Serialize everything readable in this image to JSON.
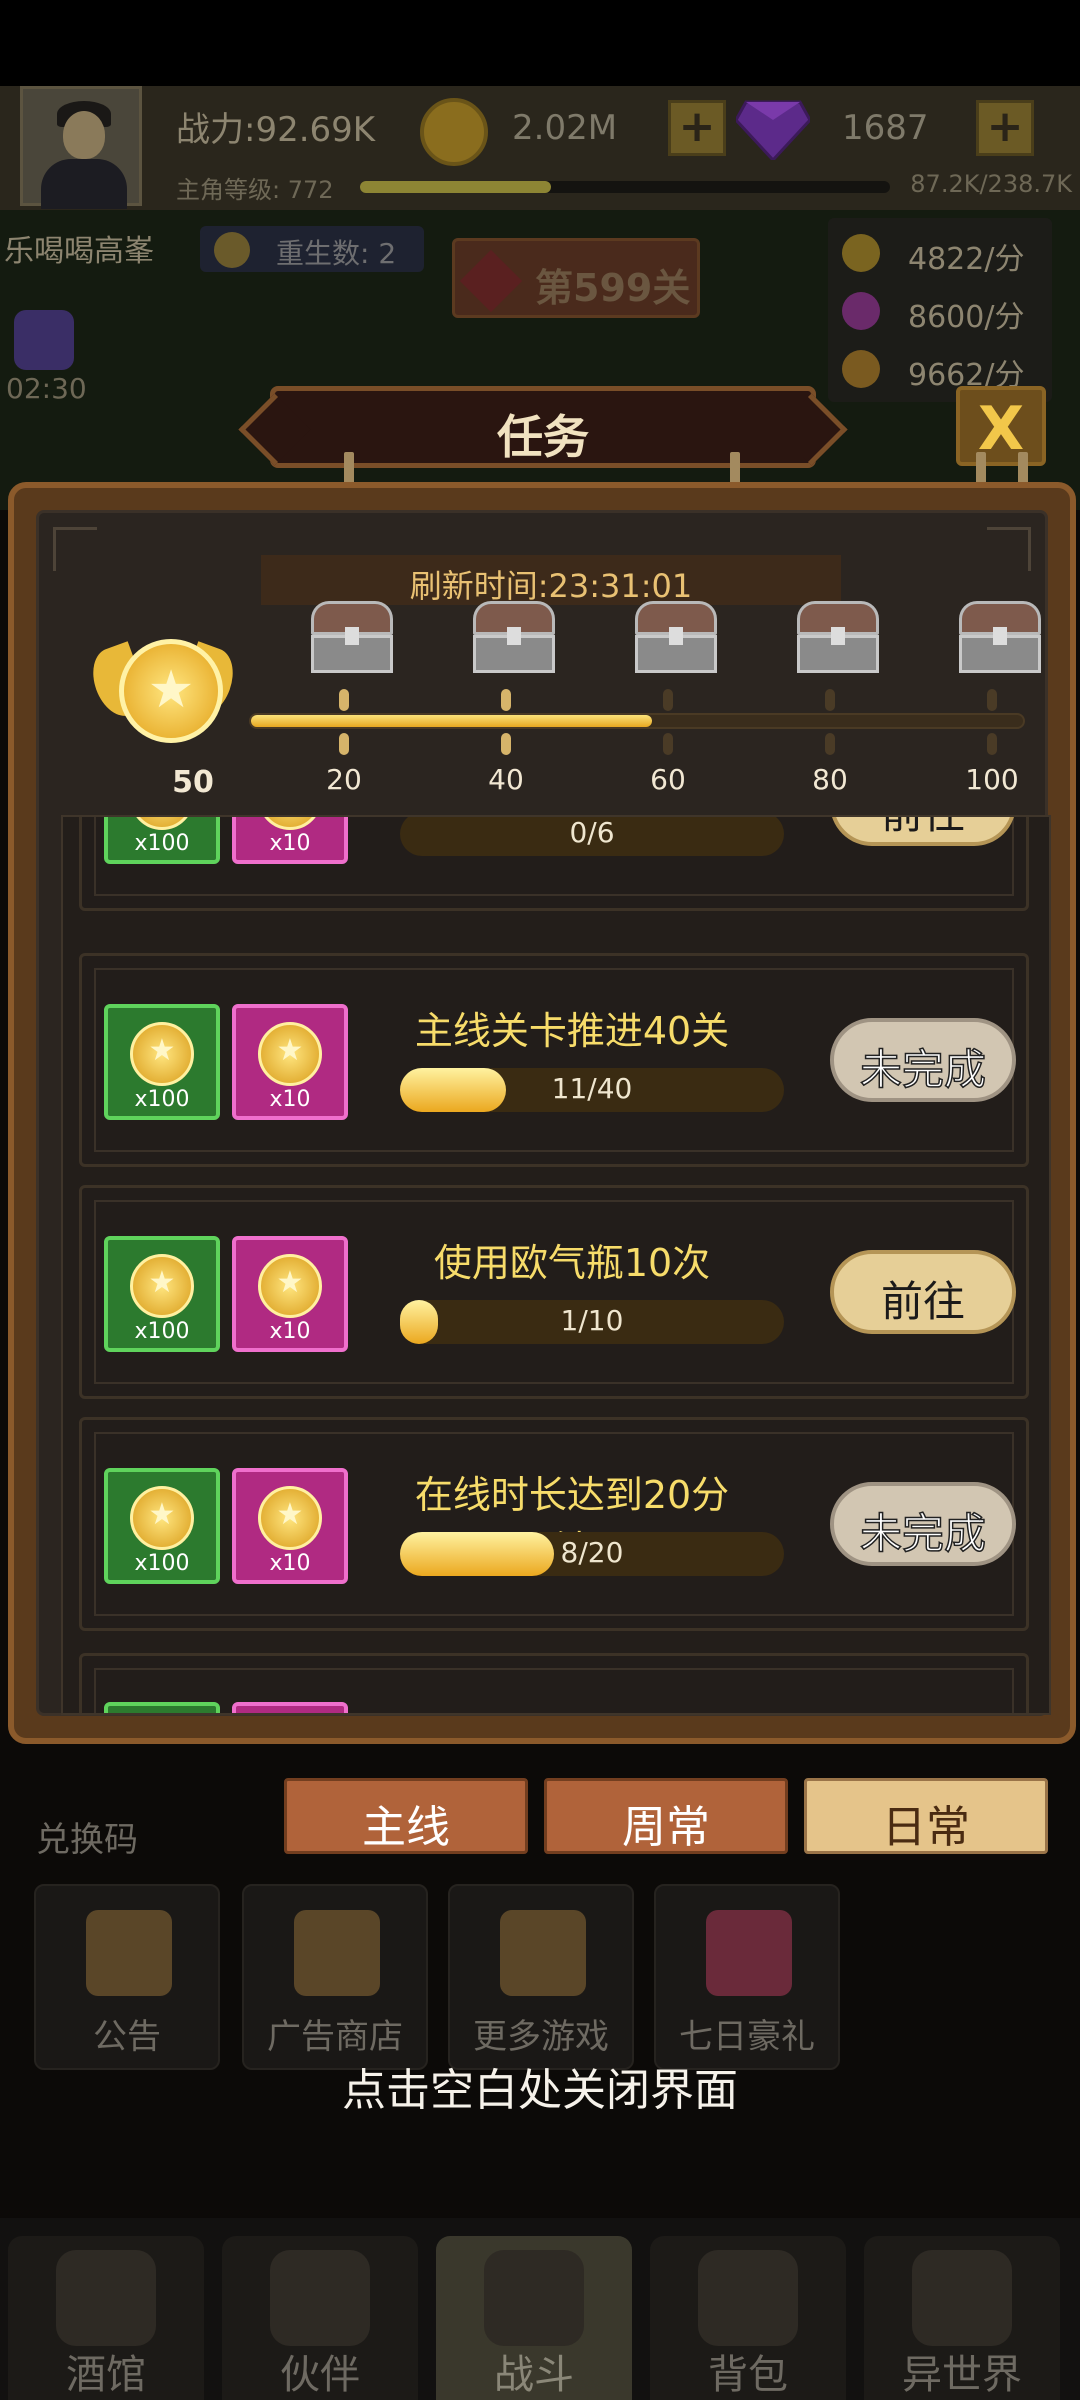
{
  "header": {
    "power": "战力:92.69K",
    "gold": "2.02M",
    "gems": "1687",
    "level_label": "主角等级: 772",
    "level_progress": 0.36,
    "exp": "87.2K/238.7K"
  },
  "scene": {
    "player_name": "乐喝喝高峯",
    "rebirth": "重生数: 2",
    "stage": "第599关",
    "skill_timer": "02:30",
    "rates": [
      "4822/分",
      "8600/分",
      "9662/分"
    ]
  },
  "dialog": {
    "title": "任务",
    "close_icon": "X",
    "refresh": "刷新时间:23:31:01",
    "medal_value": "50",
    "progress_fraction": 0.52,
    "milestones": [
      "20",
      "40",
      "60",
      "80",
      "100"
    ],
    "tasks": [
      {
        "title": "",
        "progress": "0/6",
        "fill": 0,
        "rewards": [
          "x100",
          "x10"
        ],
        "button": "前往",
        "button_style": "go"
      },
      {
        "title": "主线关卡推进40关",
        "progress": "11/40",
        "fill": 0.275,
        "rewards": [
          "x100",
          "x10"
        ],
        "button": "未完成",
        "button_style": "todo"
      },
      {
        "title": "使用欧气瓶10次",
        "progress": "1/10",
        "fill": 0.1,
        "rewards": [
          "x100",
          "x10"
        ],
        "button": "前往",
        "button_style": "go"
      },
      {
        "title": "在线时长达到20分钟",
        "progress": "8/20",
        "fill": 0.4,
        "rewards": [
          "x100",
          "x10"
        ],
        "button": "未完成",
        "button_style": "todo"
      }
    ]
  },
  "tabs": [
    "主线",
    "周常",
    "日常"
  ],
  "background_menu": {
    "redeem": "兑换码",
    "items": [
      "公告",
      "广告商店",
      "更多游戏",
      "七日豪礼"
    ]
  },
  "close_hint": "点击空白处关闭界面",
  "bottom_nav": [
    "酒馆",
    "伙伴",
    "战斗",
    "背包",
    "异世界"
  ],
  "colors": {
    "panel_border": "#8b5a2b",
    "task_title": "#f7dc6a",
    "progress_gold": "#e8a820"
  }
}
